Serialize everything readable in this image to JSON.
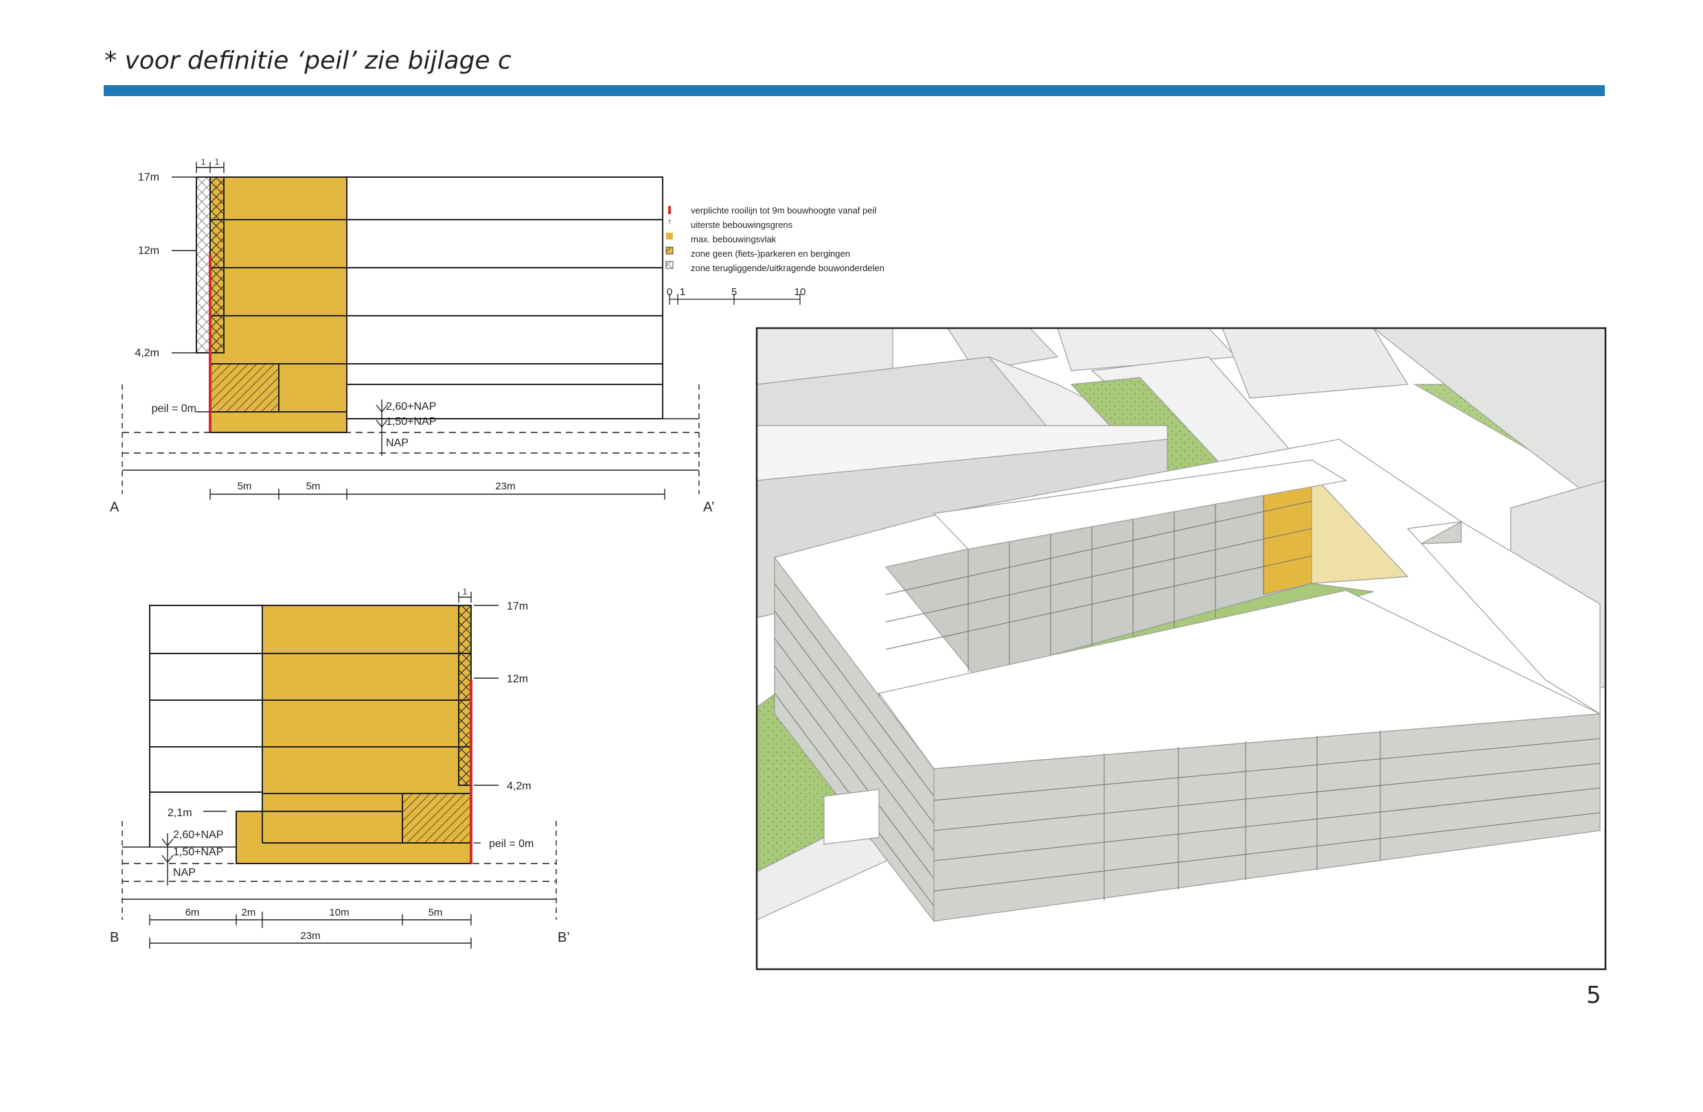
{
  "header": {
    "note": "* voor definitie ‘peil’ zie bijlage c",
    "bar_color": "#1f7ab7"
  },
  "colors": {
    "yellow": "#e3b841",
    "red": "#d22d2d",
    "green": "#a8c97a",
    "grey_facade": "#c8cbc6",
    "white": "#ffffff",
    "outline": "#231f20"
  },
  "section_a": {
    "start_label": "A",
    "end_label": "A’",
    "heights": [
      "17m",
      "12m",
      "4,2m"
    ],
    "top_dims": [
      "1",
      "1"
    ],
    "peil": "peil = 0m",
    "nap_labels": [
      "2,60+NAP",
      "1,50+NAP",
      "NAP"
    ],
    "bottom_dims": [
      "5m",
      "5m",
      "23m"
    ]
  },
  "section_b": {
    "start_label": "B",
    "end_label": "B’",
    "heights": [
      "17m",
      "12m",
      "4,2m"
    ],
    "top_dims": [
      "1"
    ],
    "extra_height": "2,1m",
    "peil": "peil = 0m",
    "nap_labels": [
      "2,60+NAP",
      "1,50+NAP",
      "NAP"
    ],
    "bottom_dims": [
      "6m",
      "2m",
      "10m",
      "5m"
    ],
    "total_dim": "23m"
  },
  "legend": {
    "items": [
      {
        "label": "verplichte rooilijn tot 9m bouwhoogte vanaf peil",
        "icon": "red-line-icon"
      },
      {
        "label": "uiterste bebouwingsgrens",
        "icon": "dashed-line-icon"
      },
      {
        "label": "max. bebouwingsvlak",
        "icon": "yellow-square-icon"
      },
      {
        "label": "zone geen (fiets-)parkeren en bergingen",
        "icon": "diagonal-hatch-icon"
      },
      {
        "label": "zone terugliggende/uitkragende bouwonderdelen",
        "icon": "cross-hatch-icon"
      }
    ],
    "scale": [
      "0",
      "1",
      "5",
      "10"
    ]
  },
  "page_number": "5"
}
